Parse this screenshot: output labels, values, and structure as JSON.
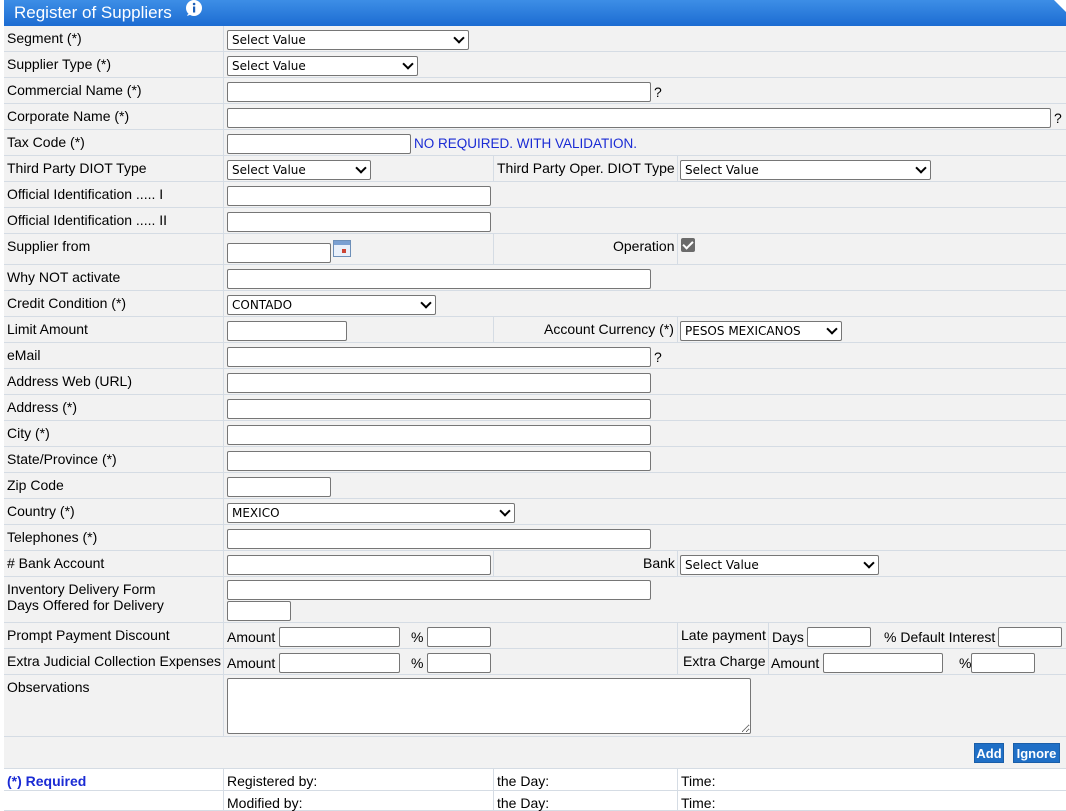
{
  "title": "Register of Suppliers",
  "select_placeholder": "Select Value",
  "help_mark": "?",
  "labels": {
    "segment": "Segment (*)",
    "supplier_type": "Supplier Type (*)",
    "commercial_name": "Commercial Name (*)",
    "corporate_name": "Corporate Name (*)",
    "tax_code": "Tax Code (*)",
    "tax_code_note": "NO REQUIRED. WITH VALIDATION.",
    "third_party_diot": "Third Party DIOT Type",
    "third_party_oper_diot": "Third Party Oper. DIOT Type",
    "official_id_1": "Official Identification ..... I",
    "official_id_2": "Official Identification ..... II",
    "supplier_from": "Supplier from",
    "operation": "Operation",
    "why_not_activate": "Why NOT activate",
    "credit_condition": "Credit Condition (*)",
    "limit_amount": "Limit Amount",
    "account_currency": "Account Currency (*)",
    "email": "eMail",
    "address_web": "Address Web (URL)",
    "address": "Address (*)",
    "city": "City (*)",
    "state": "State/Province (*)",
    "zip": "Zip Code",
    "country": "Country (*)",
    "telephones": "Telephones (*)",
    "bank_account": "# Bank Account",
    "bank": "Bank",
    "inventory_delivery": "Inventory Delivery Form",
    "days_offered": "Days Offered for Delivery",
    "prompt_payment": "Prompt Payment Discount",
    "amount": "Amount",
    "percent": "%",
    "late_payment": "Late payment",
    "days": "Days",
    "default_interest": "% Default Interest",
    "extra_judicial": "Extra Judicial Collection Expenses",
    "extra_charge": "Extra Charge",
    "observations": "Observations"
  },
  "values": {
    "credit_condition": "CONTADO",
    "account_currency": "PESOS MEXICANOS",
    "country": "MEXICO",
    "operation_checked": true
  },
  "buttons": {
    "add": "Add",
    "ignore": "Ignore"
  },
  "footer": {
    "required": "(*) Required",
    "registered_by": "Registered by:",
    "modified_by": "Modified by:",
    "the_day": "the Day:",
    "time": "Time:"
  }
}
